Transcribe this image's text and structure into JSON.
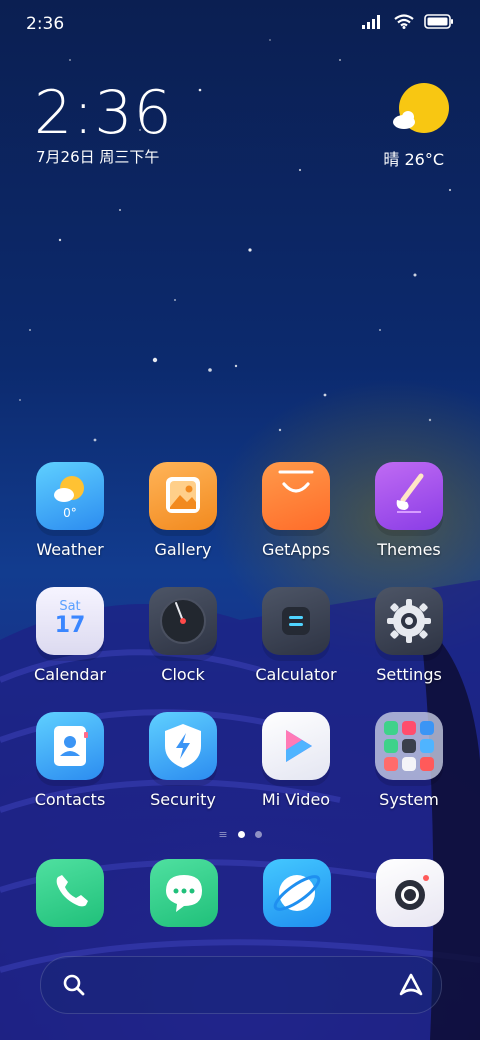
{
  "status_bar": {
    "time": "2:36",
    "icons": [
      "signal-icon",
      "wifi-icon",
      "battery-icon"
    ]
  },
  "clock_widget": {
    "time": "2:36",
    "date": "7月26日 周三下午"
  },
  "weather_widget": {
    "condition": "晴",
    "temperature": "26°C",
    "label": "晴 26°C"
  },
  "apps": [
    {
      "label": "Weather",
      "icon": "weather-icon",
      "temp": "0°"
    },
    {
      "label": "Gallery",
      "icon": "gallery-icon"
    },
    {
      "label": "GetApps",
      "icon": "getapps-icon"
    },
    {
      "label": "Themes",
      "icon": "themes-icon"
    },
    {
      "label": "Calendar",
      "icon": "calendar-icon",
      "day": "Sat",
      "date": "17"
    },
    {
      "label": "Clock",
      "icon": "clock-icon"
    },
    {
      "label": "Calculator",
      "icon": "calculator-icon"
    },
    {
      "label": "Settings",
      "icon": "settings-icon"
    },
    {
      "label": "Contacts",
      "icon": "contacts-icon"
    },
    {
      "label": "Security",
      "icon": "security-icon"
    },
    {
      "label": "Mi Video",
      "icon": "mi-video-icon"
    },
    {
      "label": "System",
      "icon": "system-folder-icon"
    }
  ],
  "page_indicator": {
    "pages": 2,
    "current": 1
  },
  "dock": [
    {
      "name": "phone",
      "icon": "phone-icon"
    },
    {
      "name": "messages",
      "icon": "messages-icon"
    },
    {
      "name": "browser",
      "icon": "browser-icon"
    },
    {
      "name": "camera",
      "icon": "camera-icon"
    }
  ],
  "search_bar": {
    "left_icon": "search-icon",
    "right_icon": "assistant-icon"
  },
  "colors": {
    "accent": "#ffffff",
    "sun": "#f8c712"
  }
}
